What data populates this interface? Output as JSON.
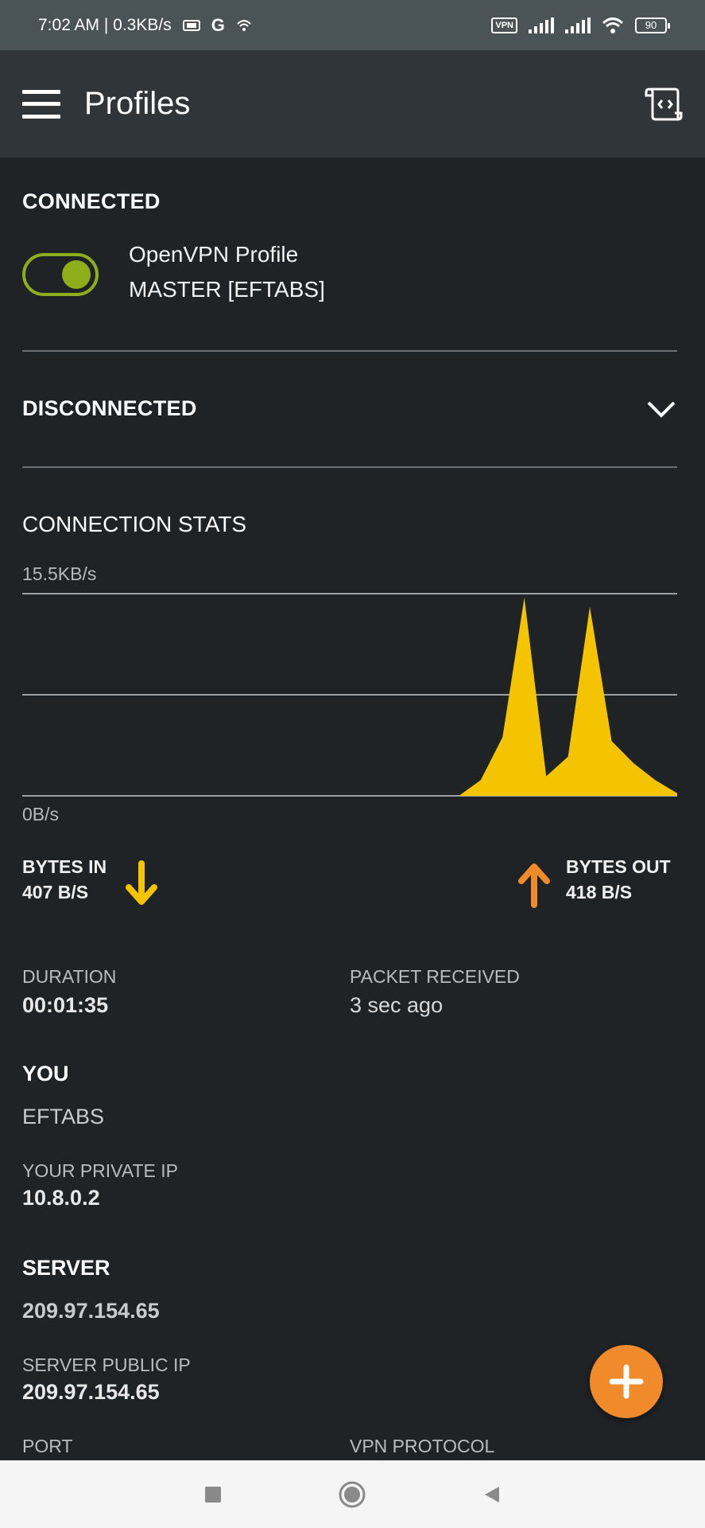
{
  "status_bar": {
    "time_speed": "7:02 AM | 0.3KB/s",
    "vpn_badge": "VPN",
    "battery": "90"
  },
  "app_bar": {
    "title": "Profiles"
  },
  "connected": {
    "title": "CONNECTED",
    "profile_name": "OpenVPN Profile",
    "profile_sub": "MASTER [EFTABS]",
    "toggle_on": true
  },
  "disconnected": {
    "title": "DISCONNECTED"
  },
  "stats": {
    "title": "CONNECTION STATS",
    "chart_data": {
      "type": "area",
      "y_max_label": "15.5KB/s",
      "y_min_label": "0B/s",
      "ylim": [
        0,
        15.5
      ],
      "color": "#f5c400",
      "x": [
        0,
        8,
        16,
        24,
        32,
        40,
        48,
        56,
        64,
        72,
        80,
        84,
        88,
        92,
        96,
        100,
        104,
        108,
        112,
        116,
        120
      ],
      "values": [
        0,
        0,
        0,
        0,
        0,
        0,
        0,
        0,
        0,
        0,
        0,
        1.2,
        4.5,
        15.2,
        1.5,
        3,
        14.5,
        4.2,
        2.5,
        1.2,
        0.2
      ]
    },
    "bytes_in_label": "BYTES IN",
    "bytes_in_value": "407 B/S",
    "bytes_out_label": "BYTES OUT",
    "bytes_out_value": "418 B/S",
    "in_color": "#f5c400",
    "out_color": "#f08a2a"
  },
  "details": {
    "duration_label": "DURATION",
    "duration_value": "00:01:35",
    "packet_label": "PACKET RECEIVED",
    "packet_value": "3 sec ago",
    "you_title": "YOU",
    "you_name": "EFTABS",
    "private_ip_label": "YOUR PRIVATE IP",
    "private_ip_value": "10.8.0.2",
    "server_title": "SERVER",
    "server_address": "209.97.154.65",
    "server_public_ip_label": "SERVER PUBLIC IP",
    "server_public_ip_value": "209.97.154.65",
    "port_label": "PORT",
    "protocol_label": "VPN PROTOCOL"
  },
  "colors": {
    "accent_green": "#8fae1b",
    "fab_orange": "#f08a2a"
  }
}
